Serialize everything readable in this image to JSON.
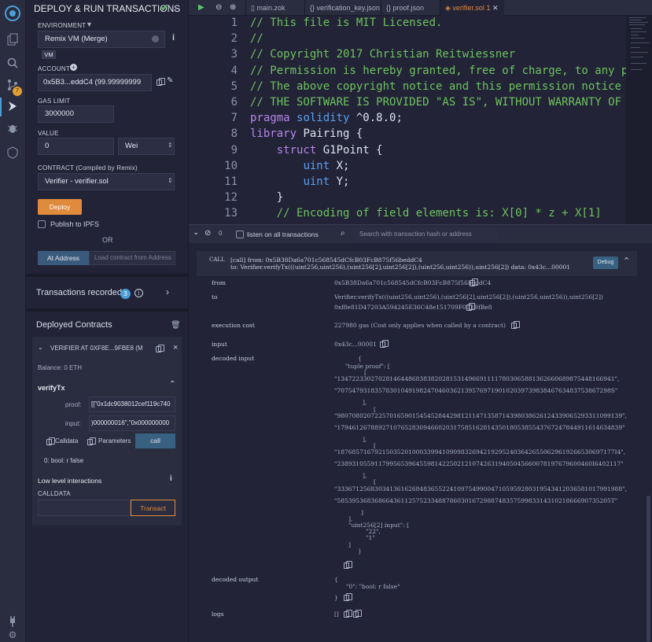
{
  "icons": [
    "remix-logo-icon",
    "file-explorer-icon",
    "search-icon",
    "git-icon",
    "deploy-icon",
    "debugger-icon",
    "verify-icon",
    "settings-icon"
  ],
  "git_badge": "7",
  "panel": {
    "title": "DEPLOY & RUN TRANSACTIONS",
    "environment_label": "ENVIRONMENT",
    "environment_value": "Remix VM (Merge)",
    "vm_badge": "VM",
    "account_label": "ACCOUNT",
    "account_value": "0x5B3...eddC4 (99.99999999",
    "gas_limit_label": "GAS LIMIT",
    "gas_limit_value": "3000000",
    "value_label": "VALUE",
    "value_amount": "0",
    "value_unit": "Wei",
    "contract_label": "CONTRACT (Compiled by Remix)",
    "contract_value": "Verifier - verifier.sol",
    "deploy_label": "Deploy",
    "publish_label": "Publish to IPFS",
    "or_label": "OR",
    "at_address_label": "At Address",
    "load_contract_placeholder": "Load contract from Address",
    "transactions_recorded": "Transactions recorded",
    "transactions_count": "3",
    "deployed_contracts": "Deployed Contracts",
    "instance_name": "VERIFIER AT 0XF8E...9FBE8 (MEI",
    "balance": "Balance: 0 ETH",
    "function_name": "verifyTx",
    "proof_label": "proof:",
    "proof_value": "[[\"0x1dc9038012cef119c740",
    "input_label": "input:",
    "input_value": ")000000016\",\"0x000000000",
    "calldata_label": "Calldata",
    "parameters_label": "Parameters",
    "call_label": "call",
    "result": "0: bool: r false",
    "low_level": "Low level interactions",
    "calldata_caption": "CALLDATA",
    "transact_label": "Transact"
  },
  "tabs": [
    "main.zok",
    "verification_key.json",
    "proof.json",
    "verifier.sol",
    "1"
  ],
  "code": [
    "// This file is MIT Licensed.",
    "//",
    "// Copyright 2017 Christian Reitwiessner",
    "// Permission is hereby granted, free of charge, to any pe",
    "// The above copyright notice and this permission notice s",
    "// THE SOFTWARE IS PROVIDED \"AS IS\", WITHOUT WARRANTY OF A",
    "pragma solidity ^0.8.0;",
    "library Pairing {",
    "    struct G1Point {",
    "        uint X;",
    "        uint Y;",
    "    }",
    "    // Encoding of field elements is: X[0] * z + X[1]"
  ],
  "terminal": {
    "count": "0",
    "listen_label": "listen on all transactions",
    "search_placeholder": "Search with transaction hash or address",
    "call_tag": "CALL",
    "call_line1": "[call] from: 0x5B38Da6a701c568545dCfcB03FcB875f56beddC4",
    "call_line2": "to: Verifier.verifyTx(((uint256,uint256),(uint256[2],uint256[2]),(uint256,uint256)),uint256[2]) data: 0x43c...00001",
    "debug_label": "Debug",
    "from_label": "from",
    "from_value": "0x5B38Da6a701c568545dCfcB03FcB875f56beddC4",
    "to_label": "to",
    "to_value1": "Verifier.verifyTx(((uint256,uint256),(uint256[2],uint256[2]),(uint256,uint256)),uint256[2])",
    "to_value2": "0xf8e81D47203A594245E36C48e151709F0C19fBe8",
    "cost_label": "execution cost",
    "cost_value": "227980 gas (Cost only applies when called by a contract)",
    "input_label": "input",
    "input_value": "0x43c...00001",
    "decoded_input_label": "decoded input",
    "decoded_input_lines": [
      "{",
      "\"tuple proof\": [",
      "[",
      "\"13472233027028146448683838202815314966911117803065881362660689875448166941\",",
      "\"7075479318357830104919824704603621395769719010203973983846763483753867298S\"",
      "],",
      "[",
      "\"9807080207225701659015454528442981211471358714398038626124339065293311099139\",",
      "\"1794612678892710765283094660203175851628143501805385543767247844911614634839\"",
      "],",
      "[",
      "\"18768571679215035201000339941090983269421929524036426550629619266530697177I4\",",
      "\"23893105591179956539645598142250212107426319405045660078197679600460I6402117\"",
      "],",
      "[",
      "\"3336712568303413616268483655224109754990047105959280319543412036581017991988\",",
      "\"5853953683686643611257523348878603016729887483575998331431021866690735205T\"",
      "]",
      "],",
      "\"uint256[2] input\": [",
      "\"22\",",
      "\"1\"",
      "]",
      "}"
    ],
    "decoded_output_label": "decoded output",
    "decoded_output_lines": [
      "{",
      "\"0\": \"bool: r false\"",
      "}"
    ],
    "logs_label": "logs",
    "logs_value": "[]"
  },
  "colors": {
    "accent": "#4a9fd8",
    "deploy": "#e08a3c",
    "badge": "#4a9fd8",
    "git_badge": "#e0a030",
    "at_address": "#3a5a7c",
    "call": "#386080"
  }
}
